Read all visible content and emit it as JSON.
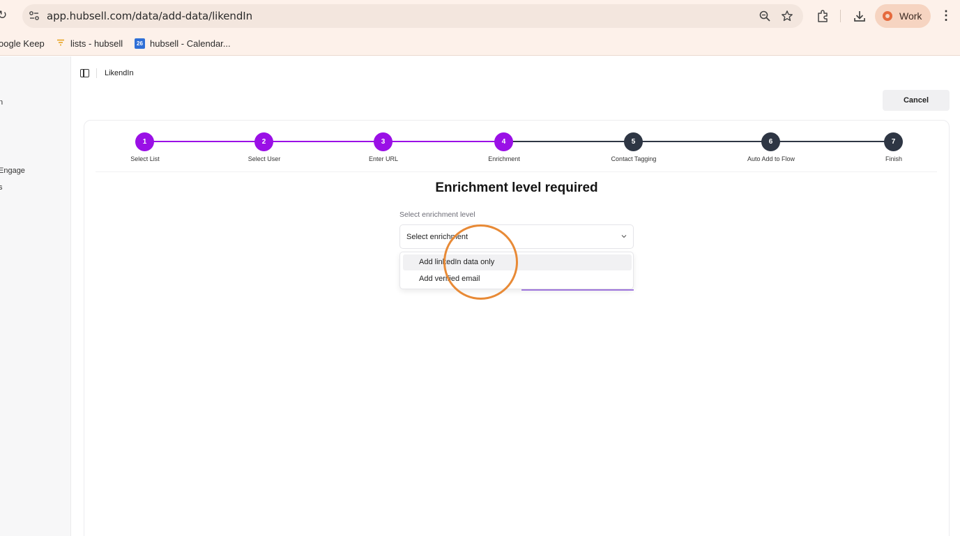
{
  "browser": {
    "url": "app.hubsell.com/data/add-data/likendIn",
    "profile_label": "Work",
    "bookmarks": [
      {
        "label": "oogle Keep"
      },
      {
        "label": "lists - hubsell"
      },
      {
        "label": "hubsell - Calendar..."
      }
    ],
    "calendar_badge": "26"
  },
  "sidebar": {
    "items": [
      {
        "label": "n"
      },
      {
        "label": "Engage"
      },
      {
        "label": "s"
      }
    ]
  },
  "header": {
    "title": "LikendIn",
    "cancel_label": "Cancel"
  },
  "stepper": {
    "steps": [
      {
        "number": "1",
        "label": "Select List",
        "status": "complete"
      },
      {
        "number": "2",
        "label": "Select User",
        "status": "complete"
      },
      {
        "number": "3",
        "label": "Enter URL",
        "status": "complete"
      },
      {
        "number": "4",
        "label": "Enrichment",
        "status": "current"
      },
      {
        "number": "5",
        "label": "Contact Tagging",
        "status": "upcoming"
      },
      {
        "number": "6",
        "label": "Auto Add to Flow",
        "status": "upcoming"
      },
      {
        "number": "7",
        "label": "Finish",
        "status": "upcoming"
      }
    ],
    "colors": {
      "active": "#9a10e6",
      "inactive": "#2e3644"
    }
  },
  "main": {
    "heading": "Enrichment level required",
    "field_label": "Select enrichment level",
    "select_placeholder": "Select enrichment",
    "options": [
      {
        "label": "Add linkedIn data only",
        "hovered": true
      },
      {
        "label": "Add verified email",
        "hovered": false
      }
    ]
  },
  "colors": {
    "chrome_bg": "#fdf1ea",
    "highlight_ring": "#e88a36"
  }
}
